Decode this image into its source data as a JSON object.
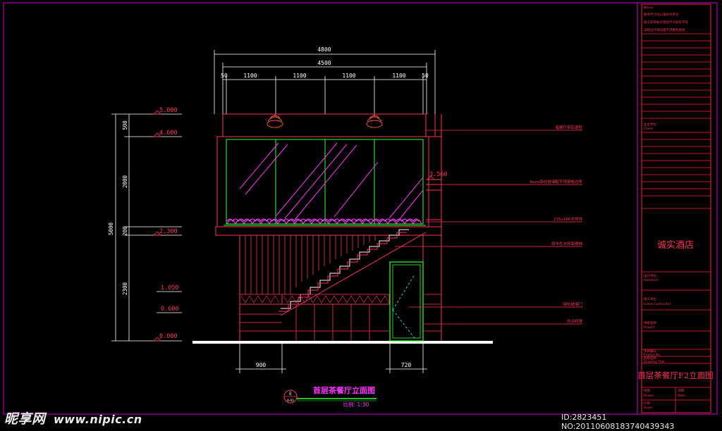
{
  "drawing": {
    "title": "首层茶餐厅立面图",
    "scale_label": "比例: 1:30",
    "symbol_top": "E",
    "symbol_bottom": "A-01"
  },
  "dimensions": {
    "top_overall": "4800",
    "top_inner": "4500",
    "top_segments": [
      "50",
      "1100",
      "1100",
      "1100",
      "1100",
      "50"
    ],
    "left_overall": "5000",
    "left_segments": [
      "500",
      "2000",
      "200",
      "2300"
    ],
    "bottom_left": "900",
    "bottom_right": "720"
  },
  "levels": [
    "5.000",
    "4.600",
    "3.560",
    "2.300",
    "1.050",
    "0.600",
    "0.000"
  ],
  "annotations": [
    "暗藏灯带及造型",
    "6mm钢化玻璃配不锈钢收边条",
    "225x140木饰线",
    "原木色木饰面楼梯",
    "钢化玻璃门",
    "仿古砖墙"
  ],
  "title_block": {
    "notes": [
      "Notes",
      "图中尺寸均以毫米为单位",
      "施工前请核对现场尺寸如有不符",
      "未经设计师同意不得更改图纸"
    ],
    "client": [
      "Client",
      "业主单位"
    ],
    "hotel_name": "诚实酒店",
    "architect": [
      "设计单位",
      "Architect"
    ],
    "contractor": [
      "施工单位",
      "Cilent Contractor"
    ],
    "project": [
      "项目名称",
      "Project"
    ],
    "project_no": [
      "项目编号",
      "Project No."
    ],
    "drawing_title_label": [
      "图纸名称",
      "Drawing Title"
    ],
    "drawing_title": "首层茶餐厅F2立面图",
    "drawn": [
      "绘图",
      "Drawn"
    ],
    "date": [
      "日期",
      "Date"
    ],
    "scale": [
      "比例",
      "Scale"
    ]
  },
  "watermark": {
    "brand": "昵享网",
    "url": "www.nipic.cn",
    "id_line": "ID:2823451 NO:20110608183740439343"
  },
  "colors": {
    "background": "#000000",
    "line_main": "#ff0055",
    "dim_white": "#ffffff",
    "green": "#33ff33",
    "magenta": "#ff33ff",
    "frame": "#cc00cc",
    "title_red": "#ff1a3c"
  }
}
